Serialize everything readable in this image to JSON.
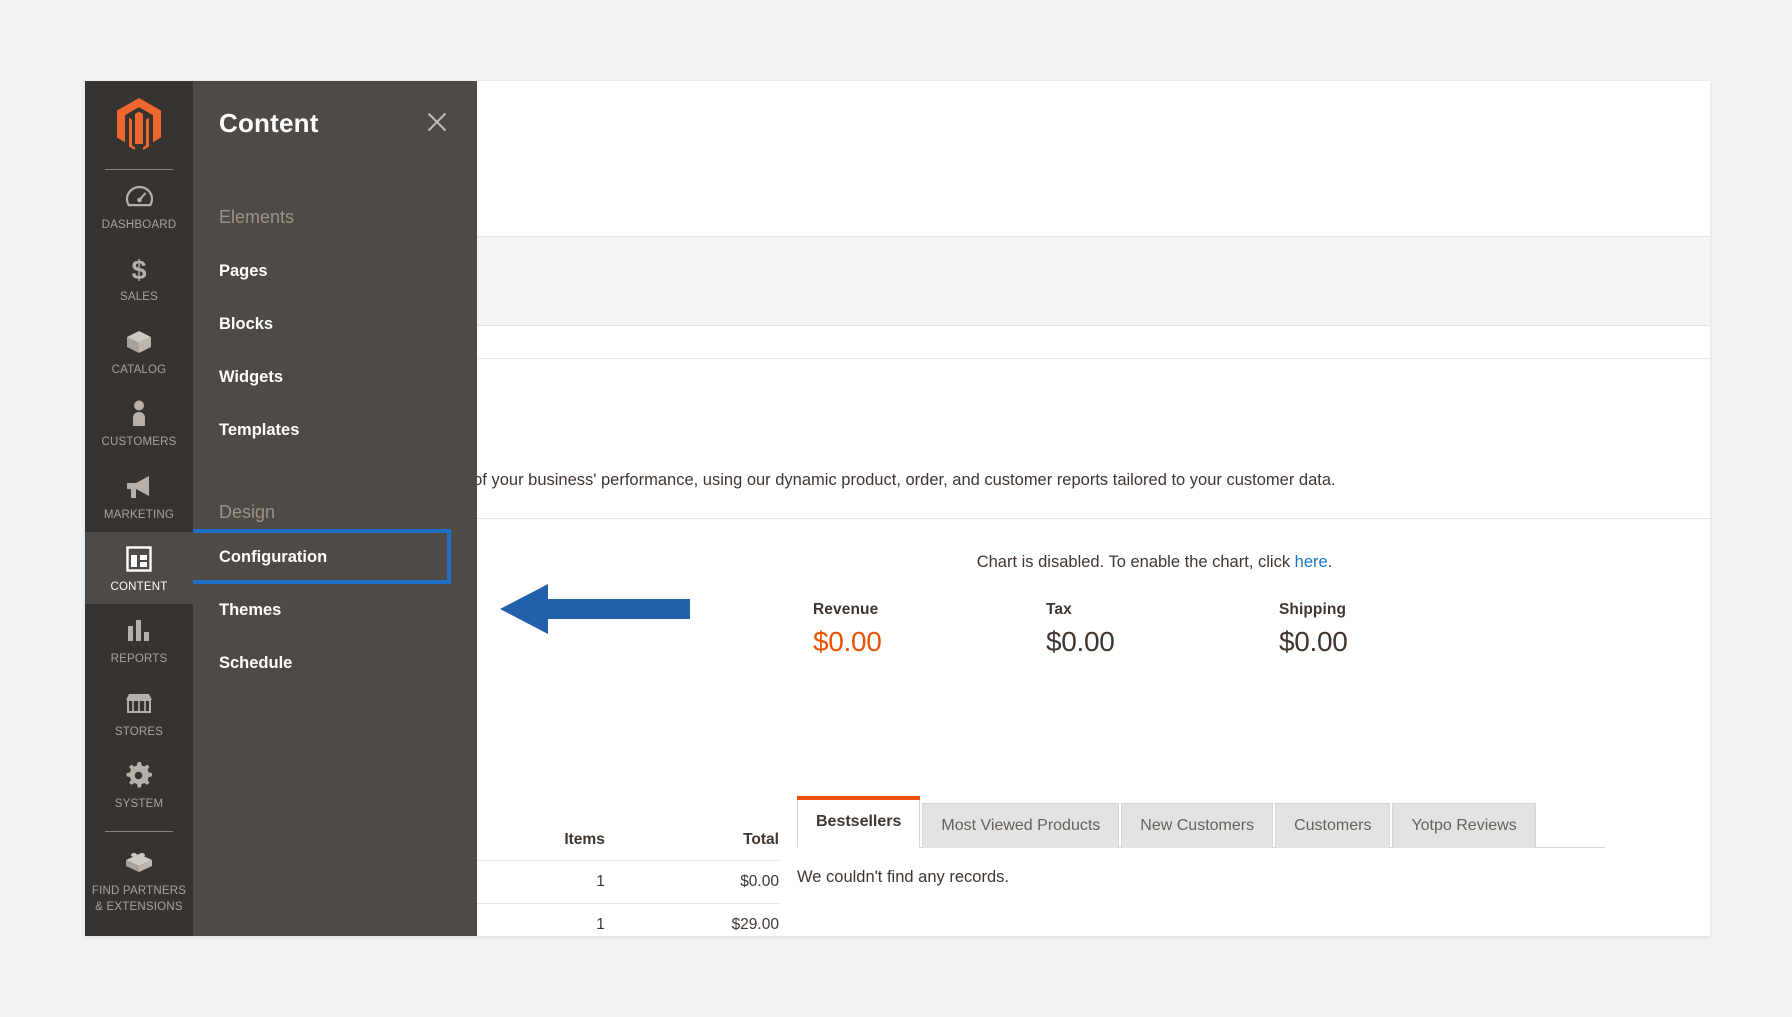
{
  "colors": {
    "accent_orange": "#eb5202",
    "sidebar_dark": "#373330",
    "flyout_grey": "#4f4a45",
    "highlight_blue": "#1f6fc4",
    "link_blue": "#1979c3"
  },
  "sidebar": {
    "logo_name": "magento-logo",
    "items": [
      {
        "label": "DASHBOARD",
        "icon": "gauge-icon",
        "active": false
      },
      {
        "label": "SALES",
        "icon": "dollar-icon",
        "active": false
      },
      {
        "label": "CATALOG",
        "icon": "box-icon",
        "active": false
      },
      {
        "label": "CUSTOMERS",
        "icon": "person-icon",
        "active": false
      },
      {
        "label": "MARKETING",
        "icon": "megaphone-icon",
        "active": false
      },
      {
        "label": "CONTENT",
        "icon": "layout-icon",
        "active": true
      },
      {
        "label": "REPORTS",
        "icon": "bar-chart-icon",
        "active": false
      },
      {
        "label": "STORES",
        "icon": "storefront-icon",
        "active": false
      },
      {
        "label": "SYSTEM",
        "icon": "gear-icon",
        "active": false
      }
    ],
    "footer_item": {
      "label_line1": "FIND PARTNERS",
      "label_line2": "& EXTENSIONS",
      "icon": "bricks-icon"
    }
  },
  "flyout": {
    "title": "Content",
    "close_label": "close-icon",
    "groups": [
      {
        "title": "Elements",
        "items": [
          {
            "label": "Pages",
            "highlighted": false
          },
          {
            "label": "Blocks",
            "highlighted": false
          },
          {
            "label": "Widgets",
            "highlighted": false
          },
          {
            "label": "Templates",
            "highlighted": false
          }
        ]
      },
      {
        "title": "Design",
        "items": [
          {
            "label": "Configuration",
            "highlighted": true
          },
          {
            "label": "Themes",
            "highlighted": false
          },
          {
            "label": "Schedule",
            "highlighted": false
          }
        ]
      }
    ]
  },
  "main": {
    "intro_text": "d of your business' performance, using our dynamic product, order, and customer reports tailored to your customer data.",
    "chart_notice_before": "Chart is disabled. To enable the chart, click ",
    "chart_notice_link": "here",
    "chart_notice_after": ".",
    "totals": [
      {
        "label": "Revenue",
        "value": "$0.00",
        "accent": true
      },
      {
        "label": "Tax",
        "value": "$0.00",
        "accent": false
      },
      {
        "label": "Shipping",
        "value": "$0.00",
        "accent": false
      }
    ],
    "tabs": [
      {
        "label": "Bestsellers",
        "active": true
      },
      {
        "label": "Most Viewed Products",
        "active": false
      },
      {
        "label": "New Customers",
        "active": false
      },
      {
        "label": "Customers",
        "active": false
      },
      {
        "label": "Yotpo Reviews",
        "active": false
      }
    ],
    "empty_message": "We couldn't find any records.",
    "mini_table": {
      "headers": {
        "items": "Items",
        "total": "Total"
      },
      "rows": [
        {
          "items": "1",
          "total": "$0.00"
        },
        {
          "items": "1",
          "total": "$29.00"
        }
      ]
    }
  },
  "annotation": {
    "arrow_name": "left-pointing-arrow",
    "arrow_color": "#2360ab"
  }
}
